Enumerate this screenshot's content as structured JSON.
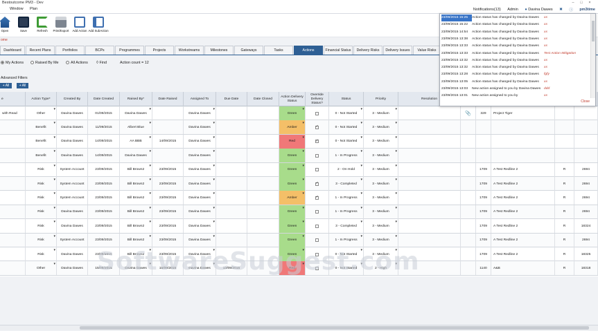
{
  "window": {
    "title": "Bestoutcome PM3 - Dev"
  },
  "menu": {
    "items": [
      "Window",
      "Plan"
    ],
    "notifications": "Notifications(13)",
    "admin": "Admin",
    "user": "Davina Dawes",
    "logo": "pm3time"
  },
  "toolbar": [
    {
      "label": "Open",
      "icon": "home-icon"
    },
    {
      "label": "Save",
      "icon": "save-icon"
    },
    {
      "label": "Refresh",
      "icon": "refresh-icon"
    },
    {
      "label": "Print/Export",
      "icon": "print-icon"
    },
    {
      "label": "Add Action",
      "icon": "add-action-icon"
    },
    {
      "label": "Add SubAction",
      "icon": "add-subaction-icon"
    }
  ],
  "crumb": "ome",
  "tabs": [
    "Dashboard",
    "Recent Plans",
    "Portfolios",
    "BCPs",
    "Programmes",
    "Projects",
    "Workstreams",
    "Milestones",
    "Gateways",
    "Tasks",
    "Actions",
    "Financial Status",
    "Delivery Risks",
    "Delivery Issues",
    "Value Risks"
  ],
  "active_tab": "Actions",
  "filters": {
    "my_actions": "My Actions",
    "raised_by_me": "Raised By Me",
    "all_actions": "All Actions",
    "find": "Find",
    "count": "Action count = 12",
    "advanced": "Advanced Filters",
    "btn_all_1": "+ All",
    "btn_all_2": "+ All"
  },
  "columns": [
    "e",
    "Action Type*",
    "Created By",
    "Date Created",
    "Raised By*",
    "Date Raised",
    "Assigned To",
    "Due Date",
    "Date Closed",
    "Action Delivery Status",
    "Override Delivery Status?",
    "Status",
    "Priority",
    "Resolution"
  ],
  "rows": [
    {
      "e": "with Read",
      "type": "Other",
      "created_by": "Davina Dawes",
      "date_created": "01/09/2015",
      "raised_by": "Davina Dawes",
      "date_raised": "",
      "assigned": "Davina Dawes",
      "due": "",
      "closed": "",
      "delivery": "Green",
      "override": false,
      "status": "0 - Not Started",
      "priority": "3 - Medium",
      "attach": true,
      "ref": "329",
      "name": "Project Tiger",
      "rag": "",
      "num": ""
    },
    {
      "e": "",
      "type": "Benefit",
      "created_by": "Davina Dawes",
      "date_created": "11/09/2015",
      "raised_by": "Albert Blue",
      "date_raised": "",
      "assigned": "Davina Dawes",
      "due": "",
      "closed": "",
      "delivery": "Amber",
      "override": true,
      "status": "0 - Not Started",
      "priority": "3 - Medium",
      "attach": false,
      "ref": "",
      "name": "",
      "rag": "",
      "num": ""
    },
    {
      "e": "",
      "type": "Benefit",
      "created_by": "Davina Dawes",
      "date_created": "14/09/2015",
      "raised_by": "AA BBB",
      "date_raised": "14/09/2015",
      "assigned": "Davina Dawes",
      "due": "",
      "closed": "",
      "delivery": "Red",
      "override": true,
      "status": "0 - Not Started",
      "priority": "3 - Medium",
      "attach": false,
      "ref": "",
      "name": "",
      "rag": "",
      "num": ""
    },
    {
      "e": "",
      "type": "Benefit",
      "created_by": "Davina Dawes",
      "date_created": "14/09/2015",
      "raised_by": "Davina Dawes",
      "date_raised": "",
      "assigned": "Davina Dawes",
      "due": "",
      "closed": "",
      "delivery": "Green",
      "override": false,
      "status": "1 - In Progress",
      "priority": "3 - Medium",
      "attach": false,
      "ref": "",
      "name": "",
      "rag": "",
      "num": ""
    },
    {
      "e": "",
      "type": "Risk",
      "created_by": "System Account",
      "date_created": "23/09/2015",
      "raised_by": "Bill Brown2",
      "date_raised": "23/09/2015",
      "assigned": "Davina Dawes",
      "due": "",
      "closed": "",
      "delivery": "Green",
      "override": false,
      "status": "2 - On Hold",
      "priority": "3 - Medium",
      "attach": false,
      "ref": "1709",
      "name": "A Test Redline 2",
      "rag": "R",
      "num": "2694"
    },
    {
      "e": "",
      "type": "Risk",
      "created_by": "System Account",
      "date_created": "23/09/2015",
      "raised_by": "Bill Brown2",
      "date_raised": "23/09/2015",
      "assigned": "Davina Dawes",
      "due": "",
      "closed": "",
      "delivery": "Green",
      "override": true,
      "status": "3 - Completed",
      "priority": "3 - Medium",
      "attach": false,
      "ref": "1709",
      "name": "A Test Redline 2",
      "rag": "R",
      "num": "2694"
    },
    {
      "e": "",
      "type": "Risk",
      "created_by": "System Account",
      "date_created": "23/09/2015",
      "raised_by": "Bill Brown2",
      "date_raised": "23/09/2015",
      "assigned": "Davina Dawes",
      "due": "",
      "closed": "",
      "delivery": "Amber",
      "override": true,
      "status": "1 - In Progress",
      "priority": "3 - Medium",
      "attach": false,
      "ref": "1709",
      "name": "A Test Redline 2",
      "rag": "R",
      "num": "2694"
    },
    {
      "e": "",
      "type": "Risk",
      "created_by": "Davina Dawes",
      "date_created": "23/09/2015",
      "raised_by": "Bill Brown2",
      "date_raised": "23/09/2015",
      "assigned": "Davina Dawes",
      "due": "",
      "closed": "",
      "delivery": "Green",
      "override": false,
      "status": "1 - In Progress",
      "priority": "3 - Medium",
      "attach": false,
      "ref": "1709",
      "name": "A Test Redline 2",
      "rag": "R",
      "num": "2694"
    },
    {
      "e": "",
      "type": "Risk",
      "created_by": "Davina Dawes",
      "date_created": "23/09/2015",
      "raised_by": "Bill Brown2",
      "date_raised": "23/09/2015",
      "assigned": "Davina Dawes",
      "due": "",
      "closed": "",
      "delivery": "Green",
      "override": false,
      "status": "3 - Completed",
      "priority": "3 - Medium",
      "attach": false,
      "ref": "1709",
      "name": "A Test Redline 2",
      "rag": "R",
      "num": "18324"
    },
    {
      "e": "",
      "type": "Risk",
      "created_by": "System Account",
      "date_created": "23/09/2015",
      "raised_by": "Bill Brown2",
      "date_raised": "23/09/2015",
      "assigned": "Davina Dawes",
      "due": "",
      "closed": "",
      "delivery": "Green",
      "override": false,
      "status": "1 - In Progress",
      "priority": "3 - Medium",
      "attach": false,
      "ref": "1709",
      "name": "A Test Redline 2",
      "rag": "R",
      "num": "2694"
    },
    {
      "e": "",
      "type": "Risk",
      "created_by": "Davina Dawes",
      "date_created": "23/09/2015",
      "raised_by": "Bill Brown2",
      "date_raised": "23/09/2015",
      "assigned": "Davina Dawes",
      "due": "",
      "closed": "",
      "delivery": "Green",
      "override": false,
      "status": "0 - Not Started",
      "priority": "3 - Medium",
      "attach": false,
      "ref": "1709",
      "name": "A Test Redline 2",
      "rag": "R",
      "num": "18325"
    },
    {
      "e": "",
      "type": "Other",
      "created_by": "Davina Dawes",
      "date_created": "15/09/2015",
      "raised_by": "Davina Dawes",
      "date_raised": "15/09/2015",
      "assigned": "Davina Dawes",
      "due": "13/09/2015",
      "closed": "",
      "delivery": "Red",
      "override": false,
      "status": "0 - Not Started",
      "priority": "2 - High",
      "attach": false,
      "ref": "1140",
      "name": "A&B",
      "rag": "R",
      "num": "18318"
    }
  ],
  "notifications": {
    "items": [
      {
        "date": "23/09/2015 15:25",
        "msg": "Action status has changed by Davina Dawes",
        "tag": "xx"
      },
      {
        "date": "23/09/2015 15:22",
        "msg": "Action status has changed by Davina Dawes",
        "tag": "xx"
      },
      {
        "date": "23/09/2015 14:54",
        "msg": "Action status has changed by Davina Dawes",
        "tag": "xx"
      },
      {
        "date": "23/09/2015 13:38",
        "msg": "Action status has changed by Davina Dawes",
        "tag": "xx"
      },
      {
        "date": "23/09/2015 13:33",
        "msg": "Action status has changed by Davina Dawes",
        "tag": "xx"
      },
      {
        "date": "23/09/2015 13:33",
        "msg": "Action status has changed by Davina Dawes",
        "tag": "Test Action Mitigation"
      },
      {
        "date": "23/09/2015 13:32",
        "msg": "Action status has changed by Davina Dawes",
        "tag": "xx"
      },
      {
        "date": "23/09/2015 13:32",
        "msg": "Action status has changed by Davina Dawes",
        "tag": "xx"
      },
      {
        "date": "23/09/2015 13:28",
        "msg": "Action status has changed by Davina Dawes",
        "tag": "fgfy"
      },
      {
        "date": "23/09/2015 13:05",
        "msg": "Action status has changed by Davina Dawes",
        "tag": "xx"
      },
      {
        "date": "23/09/2015 13:03",
        "msg": "New action assigned to you by Davina Dawes",
        "tag": "ddd"
      },
      {
        "date": "23/09/2015 13:01",
        "msg": "New action assigned to you by",
        "tag": "xx"
      }
    ],
    "close": "Close"
  },
  "watermark": "SoftwareSuggest.com",
  "colors": {
    "accent": "#2e5f94",
    "green": "#a8dc8b",
    "amber": "#f4bf68",
    "red": "#f07878"
  }
}
